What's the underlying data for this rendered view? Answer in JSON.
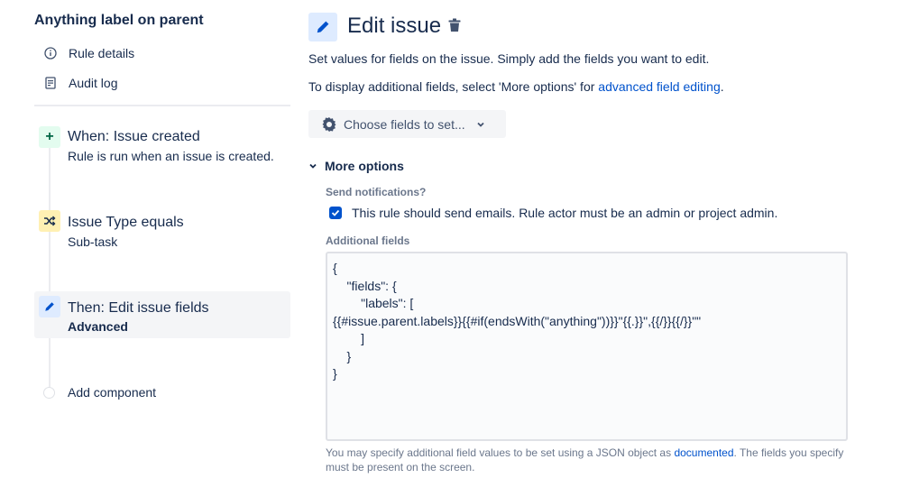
{
  "sidebar": {
    "rule_title": "Anything label on parent",
    "nav": [
      {
        "label": "Rule details",
        "icon": "info-icon"
      },
      {
        "label": "Audit log",
        "icon": "document-icon"
      }
    ],
    "steps": [
      {
        "kind": "trigger",
        "icon": "plus-icon",
        "title": "When: Issue created",
        "subtitle": "Rule is run when an issue is created.",
        "badge_color": "#E3FCEF"
      },
      {
        "kind": "condition",
        "icon": "shuffle-icon",
        "title": "Issue Type equals",
        "subtitle": "Sub-task",
        "badge_color": "#FFF0B3"
      },
      {
        "kind": "action",
        "icon": "pencil-icon",
        "title": "Then: Edit issue fields",
        "subtitle": "Advanced",
        "badge_color": "#DEEBFF",
        "selected": true
      }
    ],
    "add_component_label": "Add component"
  },
  "main": {
    "title": "Edit issue",
    "description": "Set values for fields on the issue. Simply add the fields you want to edit.",
    "more_fields_prefix": "To display additional fields, select 'More options' for ",
    "more_fields_link": "advanced field editing",
    "more_fields_suffix": ".",
    "choose_fields_label": "Choose fields to set...",
    "more_options_label": "More options",
    "send_notifications_label": "Send notifications?",
    "send_emails_checkbox": {
      "label": "This rule should send emails. Rule actor must be an admin or project admin.",
      "checked": true
    },
    "additional_fields_label": "Additional fields",
    "additional_fields_value": "{\n    \"fields\": {\n        \"labels\": [\n{{#issue.parent.labels}}{{#if(endsWith(\"anything\"))}}\"{{.}}\",{{/}}{{/}}\"\"\n        ]\n    }\n}",
    "help_prefix": "You may specify additional field values to be set using a JSON object as ",
    "help_link": "documented",
    "help_suffix": ". The fields you specify must be present on the screen."
  },
  "colors": {
    "accent": "#0052CC",
    "text": "#172B4D",
    "subtle_text": "#6B778C",
    "selected_bg": "#F4F5F7"
  }
}
